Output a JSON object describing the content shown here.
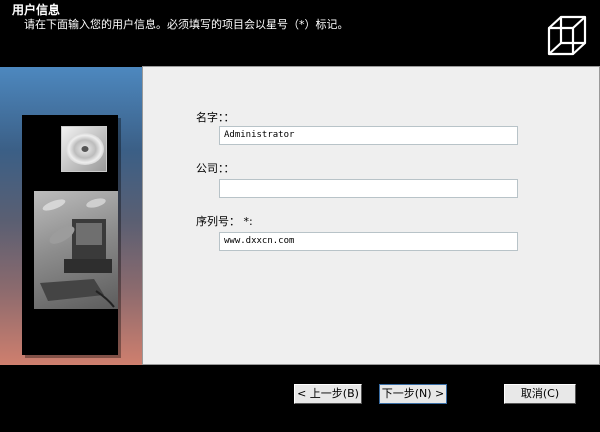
{
  "header": {
    "title": "用户信息",
    "subtitle": "请在下面输入您的用户信息。必须填写的项目会以星号（*）标记。",
    "logo_icon": "wireframe-cube-icon"
  },
  "side_panel": {
    "cd_icon": "cd-disc-icon",
    "illustration_icon": "computer-illustration-icon"
  },
  "form": {
    "name_label": "名字：：",
    "name_value": "Administrator",
    "company_label": "公司：：",
    "company_value": "",
    "serial_label": "序列号： *:",
    "serial_value": "www.dxxcn.com"
  },
  "buttons": {
    "back": "< 上一步(B)",
    "next": "下一步(N) >",
    "cancel": "取消(C)"
  },
  "colors": {
    "main_bg": "#efefef",
    "input_border": "#b8c3c8",
    "focus_border": "#3a6ea5"
  }
}
